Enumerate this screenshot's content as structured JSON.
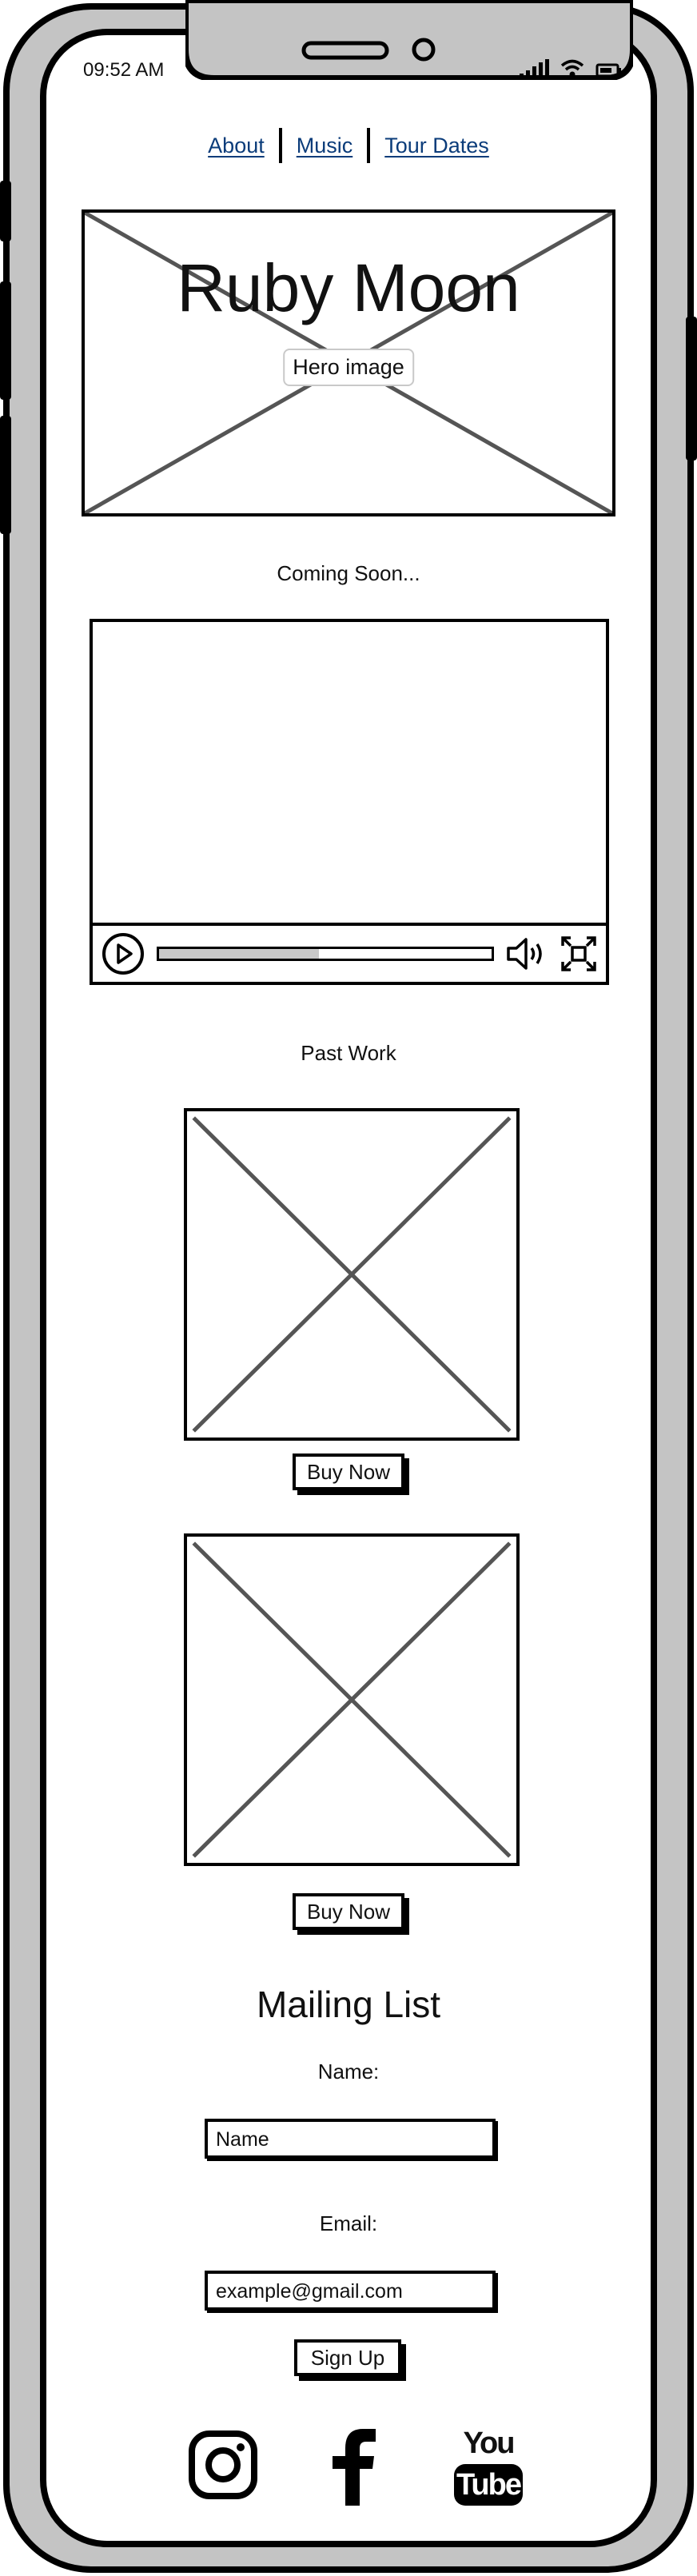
{
  "status_bar": {
    "time": "09:52 AM"
  },
  "nav": {
    "items": [
      "About",
      "Music",
      "Tour Dates"
    ]
  },
  "hero": {
    "title": "Ruby Moon",
    "image_label": "Hero image"
  },
  "coming_soon": {
    "title": "Coming Soon..."
  },
  "video": {
    "progress": 0.48
  },
  "past_work": {
    "title": "Past Work",
    "items": [
      {
        "button_label": "Buy Now"
      },
      {
        "button_label": "Buy Now"
      }
    ]
  },
  "mailing_list": {
    "title": "Mailing List",
    "name_label": "Name:",
    "name_value": "Name",
    "email_label": "Email:",
    "email_value": "example@gmail.com",
    "submit_label": "Sign Up"
  },
  "social": {
    "icons": [
      "instagram-icon",
      "facebook-icon",
      "youtube-icon"
    ],
    "youtube_text_top": "You",
    "youtube_text_bottom": "Tube"
  }
}
